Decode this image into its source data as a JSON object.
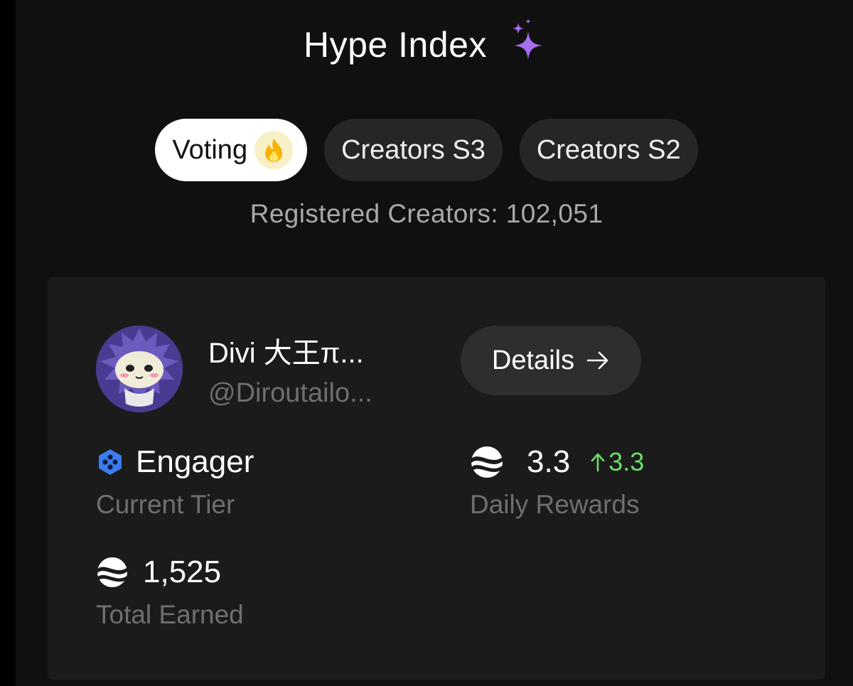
{
  "header": {
    "title": "Hype Index",
    "title_icon": "sparkle-icon"
  },
  "tabs": [
    {
      "label": "Voting",
      "active": true,
      "icon": "fire-icon"
    },
    {
      "label": "Creators S3",
      "active": false
    },
    {
      "label": "Creators S2",
      "active": false
    }
  ],
  "registered_creators": "Registered Creators: 102,051",
  "profile": {
    "name": "Divi 大王π...",
    "handle": "@Diroutailo...",
    "details_label": "Details",
    "details_icon": "arrow-right-icon"
  },
  "stats": {
    "tier": {
      "value": "Engager",
      "label": "Current Tier",
      "icon": "tier-hexagon-icon"
    },
    "daily_rewards": {
      "value": "3.3",
      "change": "3.3",
      "change_direction": "up",
      "label": "Daily Rewards",
      "icon": "token-icon"
    },
    "total_earned": {
      "value": "1,525",
      "label": "Total Earned",
      "icon": "token-icon"
    }
  },
  "colors": {
    "background": "#101010",
    "card": "#1b1b1b",
    "tab": "#262626",
    "active_tab": "#ffffff",
    "accent_positive": "#6fdc6a",
    "sparkle": "#a76ef0",
    "tier_blue": "#3d7cf0"
  }
}
